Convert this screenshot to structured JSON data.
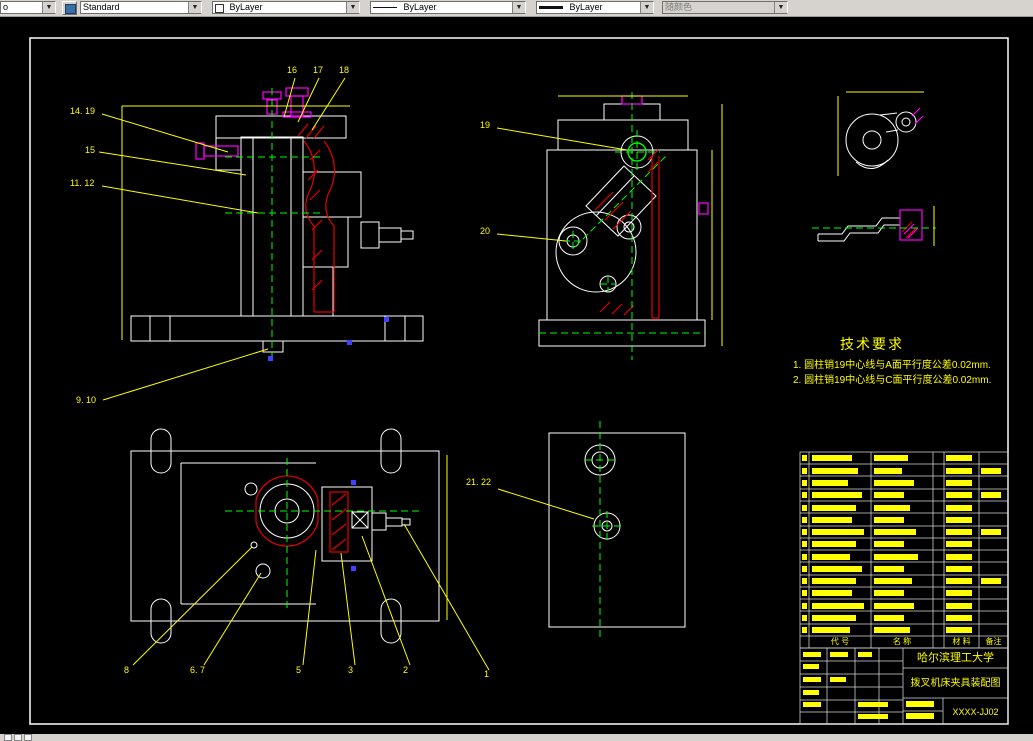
{
  "toolbar": {
    "combo1": "o",
    "style": "Standard",
    "color": "ByLayer",
    "linetype": "ByLayer",
    "lineweight": "ByLayer",
    "plot_style": "随颜色"
  },
  "callouts": {
    "front": [
      "16",
      "17",
      "18",
      "14. 19",
      "15",
      "11. 12",
      "9. 10"
    ],
    "side": [
      "19",
      "20"
    ],
    "plan": [
      "8",
      "6. 7",
      "5",
      "3",
      "2",
      "1"
    ],
    "detail": [
      "21. 22"
    ]
  },
  "tech_req": {
    "title": "技术要求",
    "item1": "1.  圆柱销19中心线与A面平行度公差0.02mm.",
    "item2": "2.  圆柱销19中心线与C面平行度公差0.02mm."
  },
  "bom": {
    "header_code": "代  号",
    "header_name": "名  称",
    "header_material": "材  料",
    "header_remark": "备注"
  },
  "title_block": {
    "org": "哈尔滨理工大学",
    "drawing_title": "拨叉机床夹具装配图",
    "drawing_no": "XXXX-JJ02"
  },
  "colors": {
    "line_white": "#ffffff",
    "part_red": "#e60000",
    "hardware_magenta": "#ff00ff",
    "center_green": "#00ff00",
    "annotation_yellow": "#ffff00",
    "mark_blue": "#4040ff"
  }
}
